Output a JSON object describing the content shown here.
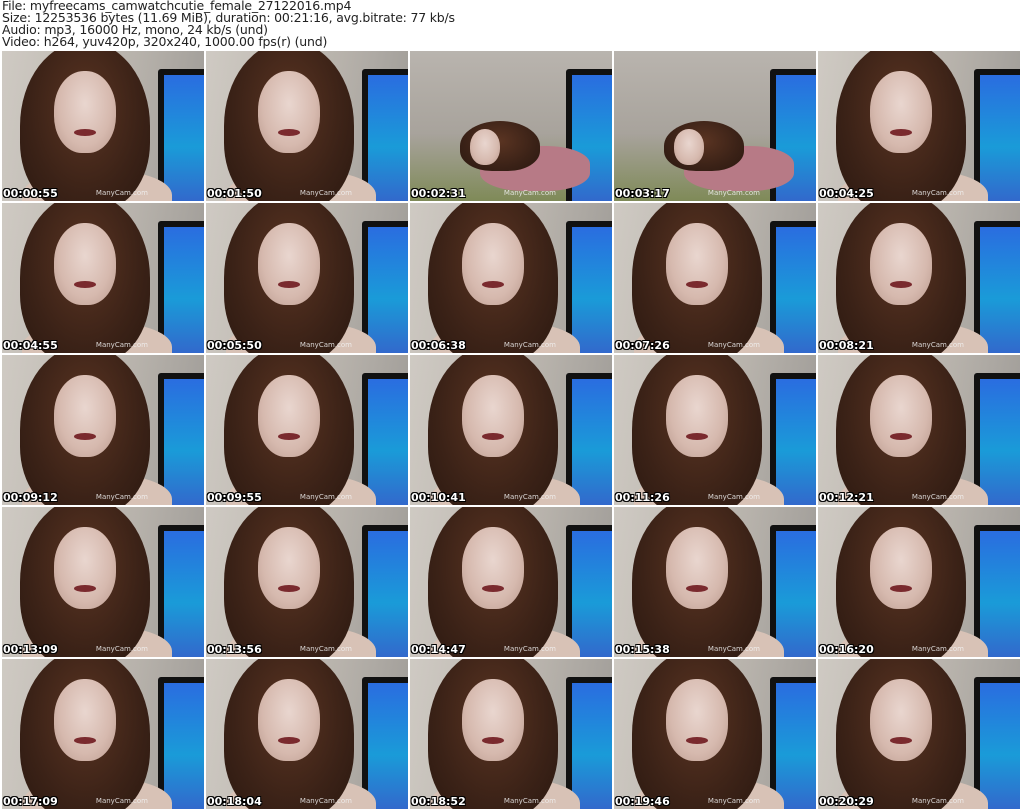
{
  "header": {
    "file": "File: myfreecams_camwatchcutie_female_27122016.mp4",
    "size": "Size: 12253536 bytes (11.69 MiB), duration: 00:21:16, avg.bitrate: 77 kb/s",
    "audio": "Audio: mp3, 16000 Hz, mono, 24 kb/s (und)",
    "video": "Video: h264, yuv420p, 320x240, 1000.00 fps(r) (und)"
  },
  "watermark": "ManyCam.com",
  "thumbnails": [
    {
      "time": "00:00:55"
    },
    {
      "time": "00:01:50"
    },
    {
      "time": "00:02:31",
      "scene": "bed"
    },
    {
      "time": "00:03:17",
      "scene": "bed"
    },
    {
      "time": "00:04:25"
    },
    {
      "time": "00:04:55"
    },
    {
      "time": "00:05:50"
    },
    {
      "time": "00:06:38"
    },
    {
      "time": "00:07:26"
    },
    {
      "time": "00:08:21"
    },
    {
      "time": "00:09:12"
    },
    {
      "time": "00:09:55"
    },
    {
      "time": "00:10:41"
    },
    {
      "time": "00:11:26"
    },
    {
      "time": "00:12:21"
    },
    {
      "time": "00:13:09"
    },
    {
      "time": "00:13:56"
    },
    {
      "time": "00:14:47"
    },
    {
      "time": "00:15:38"
    },
    {
      "time": "00:16:20"
    },
    {
      "time": "00:17:09"
    },
    {
      "time": "00:18:04"
    },
    {
      "time": "00:18:52"
    },
    {
      "time": "00:19:46"
    },
    {
      "time": "00:20:29"
    }
  ]
}
